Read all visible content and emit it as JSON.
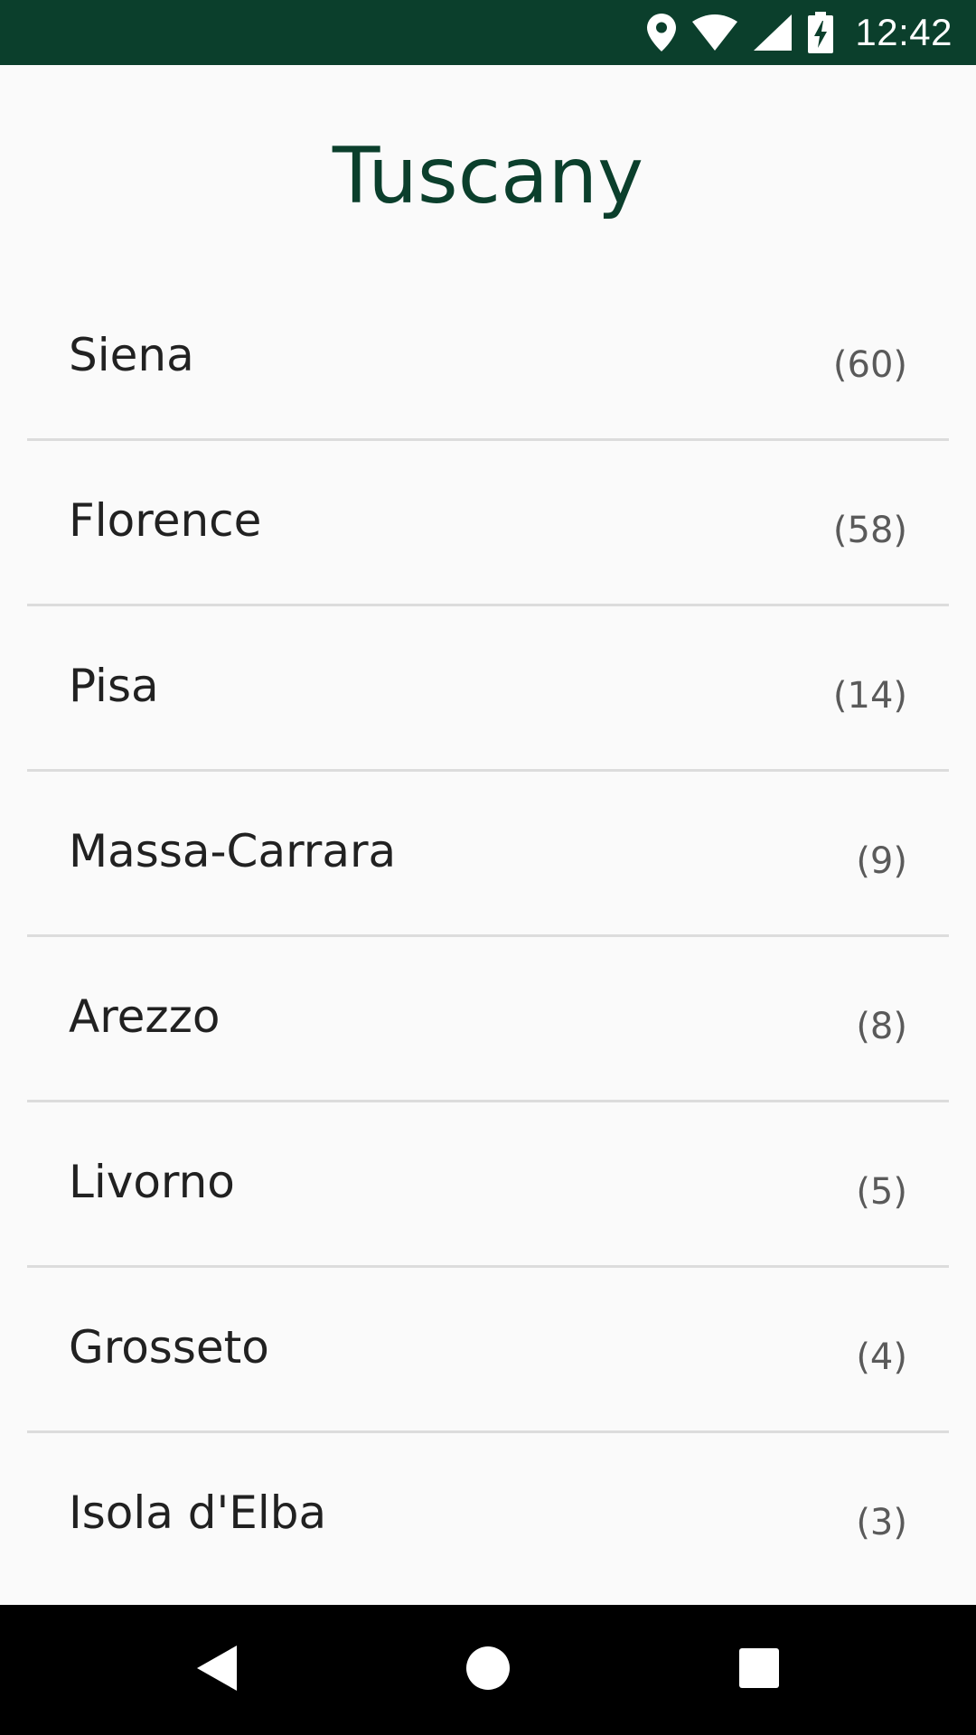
{
  "status_bar": {
    "time": "12:42",
    "icons": [
      "location-pin-icon",
      "wifi-icon",
      "cell-signal-icon",
      "battery-charging-icon"
    ],
    "background": "#0b3f2c"
  },
  "header": {
    "title": "Tuscany",
    "title_color": "#0b3f2c"
  },
  "regions": [
    {
      "name": "Siena",
      "count": "(60)"
    },
    {
      "name": "Florence",
      "count": "(58)"
    },
    {
      "name": "Pisa",
      "count": "(14)"
    },
    {
      "name": "Massa-Carrara",
      "count": "(9)"
    },
    {
      "name": "Arezzo",
      "count": "(8)"
    },
    {
      "name": "Livorno",
      "count": "(5)"
    },
    {
      "name": "Grosseto",
      "count": "(4)"
    },
    {
      "name": "Isola d'Elba",
      "count": "(3)"
    }
  ],
  "nav_bar": {
    "buttons": [
      "back-icon",
      "home-icon",
      "recents-icon"
    ]
  }
}
